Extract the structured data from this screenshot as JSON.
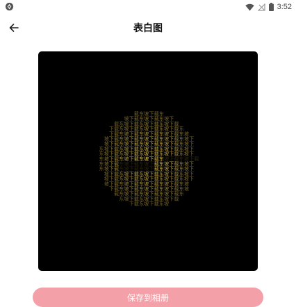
{
  "status_bar": {
    "time": "3:52",
    "icons": [
      "app-notification-icon",
      "wifi-icon",
      "sim-no-signal-icon",
      "battery-icon"
    ]
  },
  "header": {
    "back_icon": "arrow-left-icon",
    "title": "表白图"
  },
  "preview": {
    "text_pattern": "东坡下载",
    "background_color": "#000000",
    "text_color": "#e8c95a"
  },
  "actions": {
    "save_label": "保存到相册",
    "save_color": "#f4a0a8"
  }
}
